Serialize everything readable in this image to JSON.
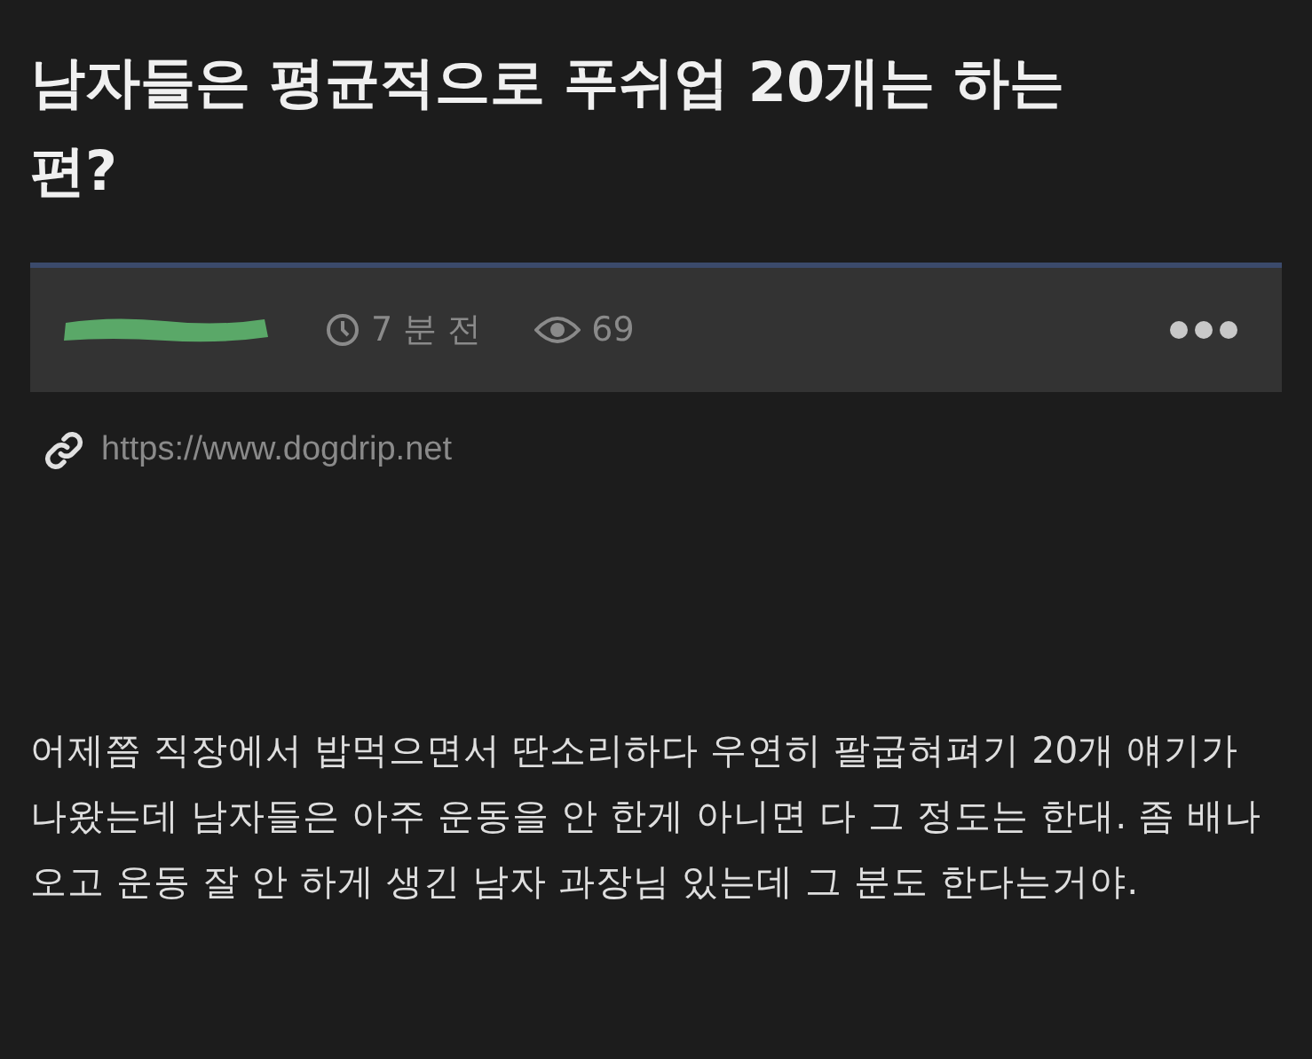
{
  "post": {
    "title": "남자들은 평균적으로 푸쉬업 20개는 하는 편?",
    "meta": {
      "author_redacted": true,
      "time": "7 분 전",
      "views": "69"
    },
    "link": "https://www.dogdrip.net",
    "body": "어제쯤 직장에서 밥먹으면서 딴소리하다 우연히 팔굽혀펴기 20개 얘기가 나왔는데 남자들은 아주 운동을 안 한게 아니면 다 그 정도는 한대. 좀 배나오고 운동 잘 안 하게 생긴 남자 과장님 있는데 그 분도 한다는거야."
  }
}
